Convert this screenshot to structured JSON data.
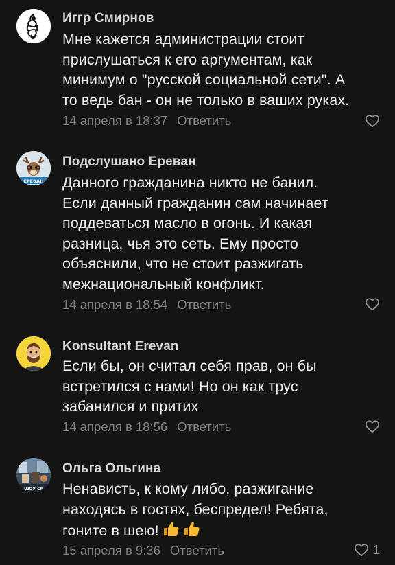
{
  "comments": [
    {
      "author": "Иггр Смирнов",
      "lines": [
        "Мне кажется администрации стоит",
        "прислушаться к его аргументам, как",
        "минимум о \"русской социальной сети\". А",
        "то ведь бан - он не только в ваших руках."
      ],
      "date": "14 апреля в 18:37",
      "reply": "Ответить",
      "likes": "",
      "avatar_icon": "ornament-figure-icon"
    },
    {
      "author": "Подслушано Ереван",
      "lines": [
        "Данного гражданина никто не банил.",
        "Если данный гражданин сам начинает",
        "поддеваться масло в огонь. И какая",
        "разница, чья это сеть. Ему просто",
        "объяснили, что не стоит разжигать",
        "межнациональный конфликт."
      ],
      "date": "14 апреля в 18:54",
      "reply": "Ответить",
      "likes": "",
      "avatar_icon": "deer-icon",
      "avatar_text": "ЕРЕВАН"
    },
    {
      "author": "Konsultant Erevan",
      "lines": [
        "Если бы, он считал себя прав, он бы",
        "встретился с нами! Но он как трус",
        "забанился и притих"
      ],
      "date": "14 апреля в 18:56",
      "reply": "Ответить",
      "likes": "",
      "avatar_icon": "bearded-man-icon"
    },
    {
      "author": "Ольга Ольгина",
      "lines": [
        "Ненависть, к кому либо, разжигание",
        "находясь в гостях, беспредел! Ребята,",
        "гоните в шею!"
      ],
      "emojis": [
        "thumbs-up-icon",
        "thumbs-up-icon"
      ],
      "date": "15 апреля в 9:36",
      "reply": "Ответить",
      "likes": "1",
      "avatar_icon": "room-photo-icon",
      "avatar_text": "ШОУ СР"
    }
  ],
  "colors": {
    "background": "#141414",
    "text": "#eceef0",
    "author": "#d4d7db",
    "meta": "#7d8287",
    "thumbs": "#f5b82e"
  }
}
